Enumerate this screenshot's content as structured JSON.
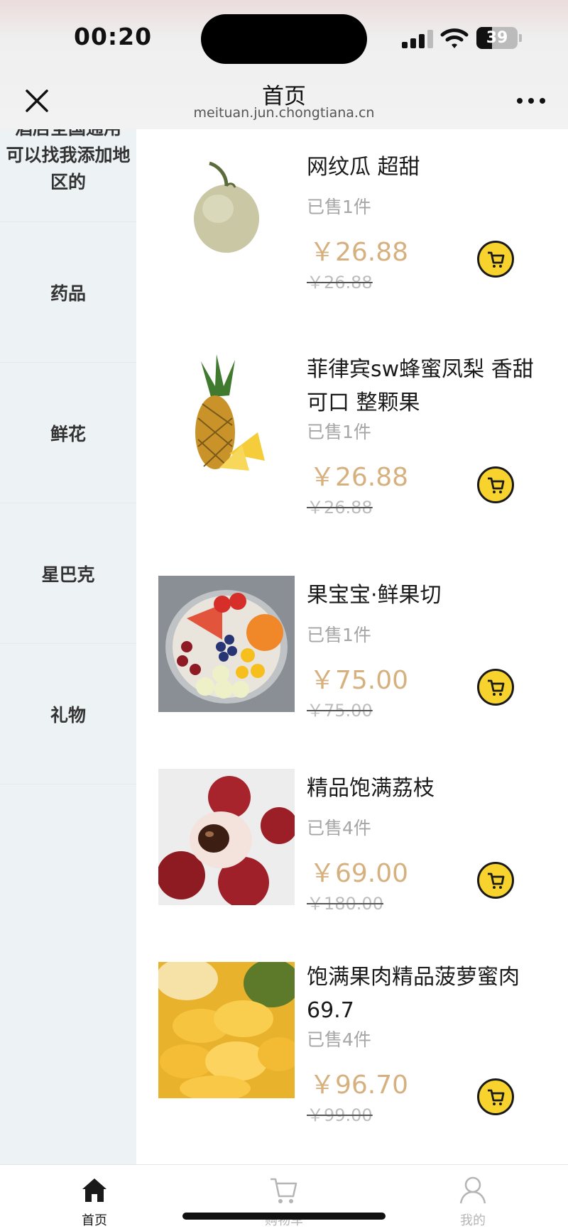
{
  "status_bar": {
    "time": "00:20",
    "battery": "39"
  },
  "header": {
    "title": "首页",
    "url": "meituan.jun.chongtiana.cn"
  },
  "sidebar": {
    "partial_text": [
      "酒店全国通用",
      "可以找我添加地",
      "区的"
    ],
    "items": [
      {
        "label": "药品"
      },
      {
        "label": "鲜花"
      },
      {
        "label": "星巴克"
      },
      {
        "label": "礼物"
      }
    ]
  },
  "products": [
    {
      "name": "网纹瓜 超甜",
      "sold": "已售1件",
      "price": "￥26.88",
      "original_price": "￥26.88",
      "image": "melon-image"
    },
    {
      "name": "菲律宾sw蜂蜜凤梨 香甜可口 整颗果",
      "sold": "已售1件",
      "price": "￥26.88",
      "original_price": "￥26.88",
      "image": "pineapple-image"
    },
    {
      "name": "果宝宝·鲜果切",
      "sold": "已售1件",
      "price": "￥75.00",
      "original_price": "￥75.00",
      "image": "fruit-platter-image"
    },
    {
      "name": "精品饱满荔枝",
      "sold": "已售4件",
      "price": "￥69.00",
      "original_price": "￥180.00",
      "image": "lychee-image"
    },
    {
      "name": "饱满果肉精品菠萝蜜肉 69.7",
      "sold": "已售4件",
      "price": "￥96.70",
      "original_price": "￥99.00",
      "image": "jackfruit-image"
    }
  ],
  "tabbar": {
    "tabs": [
      {
        "label": "首页",
        "icon": "home-icon",
        "active": true
      },
      {
        "label": "购物车",
        "icon": "cart-icon",
        "active": false
      },
      {
        "label": "我的",
        "icon": "user-icon",
        "active": false
      }
    ]
  },
  "colors": {
    "price": "#d6b17f",
    "cart_button": "#f8d32d",
    "sidebar_bg": "#edf3f5"
  }
}
